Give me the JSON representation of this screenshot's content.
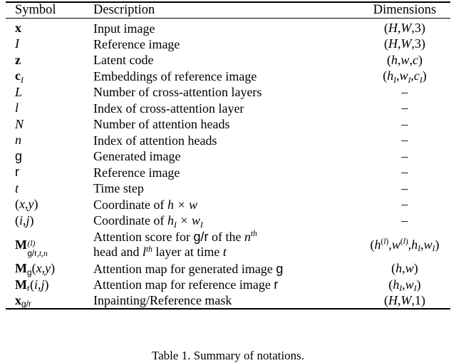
{
  "table": {
    "headers": {
      "symbol": "Symbol",
      "description": "Description",
      "dimensions": "Dimensions"
    },
    "rows": [
      {
        "symbol": "x",
        "description": "Input image",
        "dimensions": "(H, W, 3)"
      },
      {
        "symbol": "I",
        "description": "Reference image",
        "dimensions": "(H, W, 3)"
      },
      {
        "symbol": "z",
        "description": "Latent code",
        "dimensions": "(h, w, c)"
      },
      {
        "symbol": "c_I",
        "description": "Embeddings of reference image",
        "dimensions": "(h_I, w_I, c_I)"
      },
      {
        "symbol": "L",
        "description": "Number of cross-attention layers",
        "dimensions": "–"
      },
      {
        "symbol": "l",
        "description": "Index of cross-attention layer",
        "dimensions": "–"
      },
      {
        "symbol": "N",
        "description": "Number of attention heads",
        "dimensions": "–"
      },
      {
        "symbol": "n",
        "description": "Index of attention heads",
        "dimensions": "–"
      },
      {
        "symbol": "g",
        "description": "Generated image",
        "dimensions": "–"
      },
      {
        "symbol": "r",
        "description": "Reference image",
        "dimensions": "–"
      },
      {
        "symbol": "t",
        "description": "Time step",
        "dimensions": "–"
      },
      {
        "symbol": "(x, y)",
        "description": "Coordinate of h × w",
        "dimensions": "–"
      },
      {
        "symbol": "(i, j)",
        "description": "Coordinate of h_I × w_I",
        "dimensions": "–"
      },
      {
        "symbol": "M^(l)_g/r,t,n",
        "description": "Attention score for g/r of the n-th head and l-th layer at time t",
        "dimensions": "(h^(l), w^(l), h_I, w_I)"
      },
      {
        "symbol": "M_g(x, y)",
        "description": "Attention map for generated image g",
        "dimensions": "(h, w)"
      },
      {
        "symbol": "M_r(i, j)",
        "description": "Attention map for reference image r",
        "dimensions": "(h_I, w_I)"
      },
      {
        "symbol": "x_g/r",
        "description": "Inpainting/Reference mask",
        "dimensions": "(H, W, 1)"
      }
    ],
    "row_text_fragments": {
      "input_image": "Input image",
      "reference_image": "Reference image",
      "latent_code": "Latent code",
      "embeddings_of_reference_image": "Embeddings of reference image",
      "number_of_cross_attention_layers": "Number of cross-attention layers",
      "index_of_cross_attention_layer": "Index of cross-attention layer",
      "number_of_attention_heads": "Number of attention heads",
      "index_of_attention_heads": "Index of attention heads",
      "generated_image": "Generated image",
      "reference_image_2": "Reference image",
      "time_step": "Time step",
      "coordinate_of": "Coordinate of",
      "attention_score_for": "Attention score for",
      "of_the": "of the",
      "head_and": "head and",
      "layer_at_time": "layer at time",
      "attention_map_for_generated_image": "Attention map for generated image",
      "attention_map_for_reference_image": "Attention map for reference image",
      "inpainting_reference_mask": "Inpainting/Reference mask",
      "dash": "–",
      "times": "×",
      "slash": "/",
      "comma": ",",
      "th": "th",
      "lparen": "(",
      "rparen": ")"
    },
    "symbols": {
      "x": "x",
      "I": "I",
      "z": "z",
      "c": "c",
      "L": "L",
      "l": "l",
      "N": "N",
      "n": "n",
      "g": "g",
      "r": "r",
      "t": "t",
      "y": "y",
      "i": "i",
      "j": "j",
      "M": "M",
      "H": "H",
      "W": "W",
      "h": "h",
      "w": "w",
      "three": "3",
      "one": "1"
    }
  },
  "caption": {
    "label": "Table 1.",
    "text": "Summary of notations."
  }
}
